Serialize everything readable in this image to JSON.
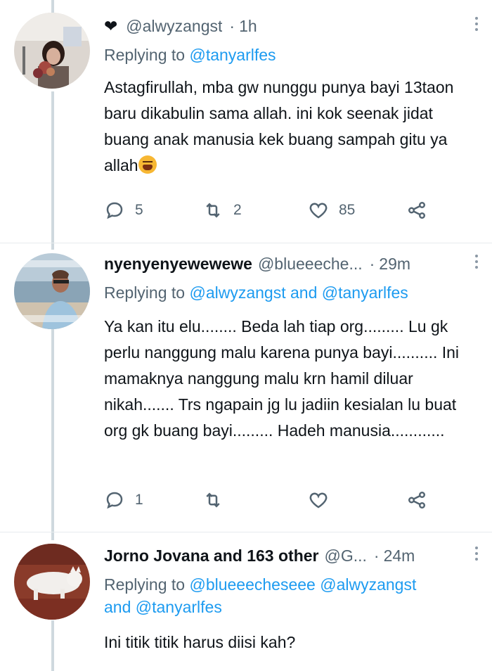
{
  "tweets": [
    {
      "name_prefix_icon": "heart-icon",
      "name": "",
      "handle": "@alwyzangst",
      "time": "1h",
      "replying_prefix": "Replying to",
      "replying_mentions": "@tanyarlfes",
      "replying_suffix": "",
      "replying_line2": "",
      "text": "Astagfirullah, mba gw nunggu punya bayi 13taon baru dikabulin sama allah. ini kok seenak jidat buang anak manusia kek buang sampah gitu ya allah",
      "emoji": "tired-face-emoji",
      "reply_count": "5",
      "retweet_count": "2",
      "like_count": "85"
    },
    {
      "name": "nyenyenyewewewe",
      "handle": "@blueeeche...",
      "time": "29m",
      "replying_prefix": "Replying to",
      "replying_mentions": "@alwyzangst and @tanyarlfes",
      "replying_suffix": "",
      "replying_line2": "",
      "text": "Ya kan itu elu........ Beda lah tiap org......... Lu gk perlu nanggung malu karena punya bayi.......... Ini mamaknya nanggung malu krn hamil diluar nikah....... Trs ngapain jg lu jadiin kesialan lu buat org gk buang bayi......... Hadeh manusia............",
      "reply_count": "1",
      "retweet_count": "",
      "like_count": ""
    },
    {
      "name": "Jorno Jovana and 163 other",
      "handle": "@G...",
      "time": "24m",
      "replying_prefix": "Replying to",
      "replying_mentions": "@blueeecheseee @alwyzangst",
      "replying_suffix": "and @tanyarlfes",
      "text": "Ini titik titik harus diisi kah?"
    }
  ],
  "colors": {
    "accent": "#1d9bf0",
    "secondary_text": "#536471",
    "thread_line": "#cfd9de"
  }
}
